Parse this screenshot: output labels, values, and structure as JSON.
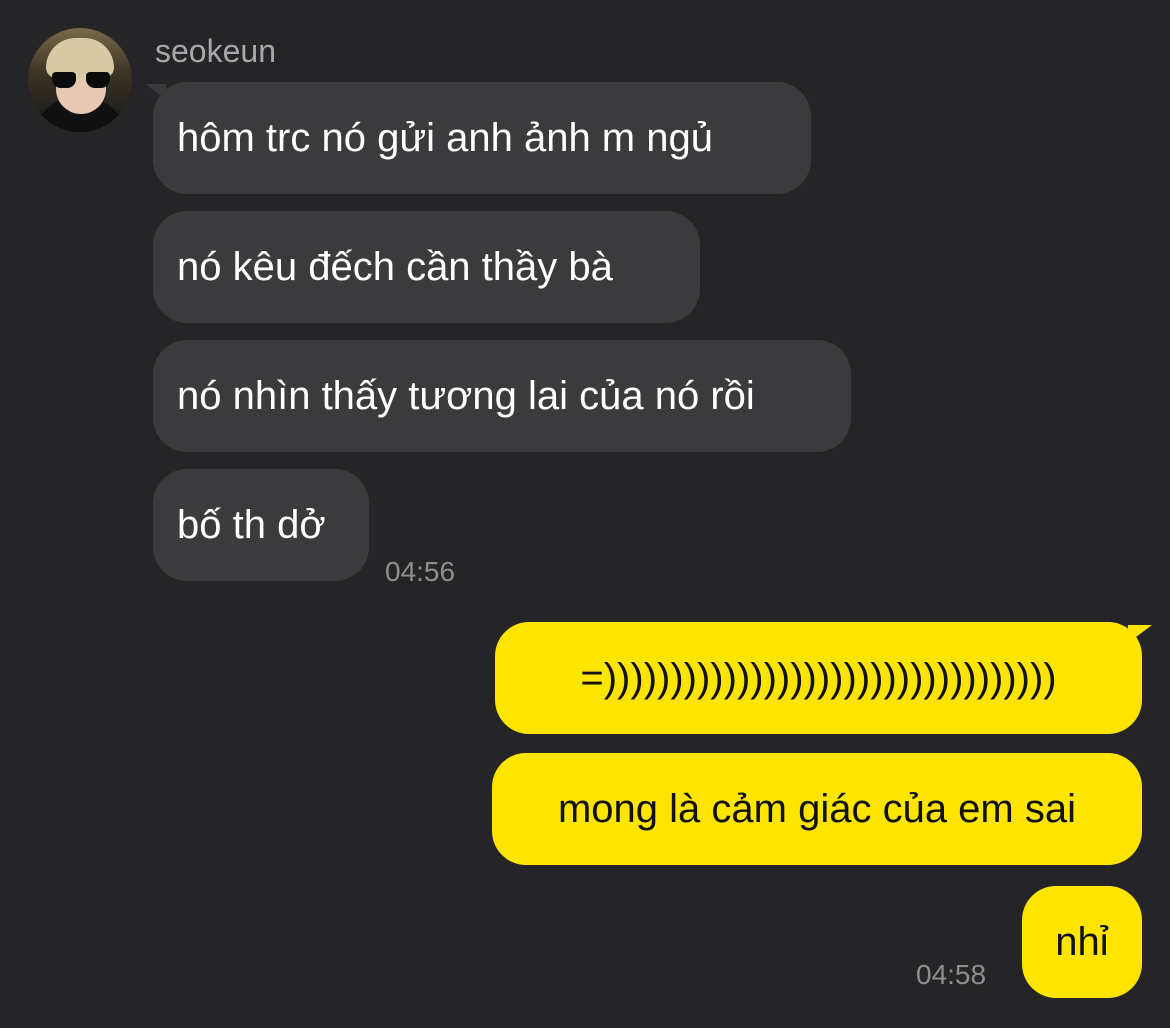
{
  "conversation": {
    "sender": {
      "name": "seokeun",
      "avatar_icon": "profile-avatar"
    },
    "incoming_messages": [
      "hôm trc nó gửi anh ảnh m ngủ",
      "nó kêu đếch cần thầy bà",
      "nó nhìn thấy tương lai của nó rồi",
      "bố th dở"
    ],
    "incoming_time": "04:56",
    "outgoing_messages": [
      "=))))))))))))))))))))))))))))))))))",
      "mong là cảm giác của em sai",
      "nhỉ"
    ],
    "outgoing_time": "04:58"
  },
  "colors": {
    "background": "#252527",
    "incoming_bubble": "#3b3b3d",
    "outgoing_bubble": "#fee500",
    "timestamp": "#8e8e90"
  }
}
